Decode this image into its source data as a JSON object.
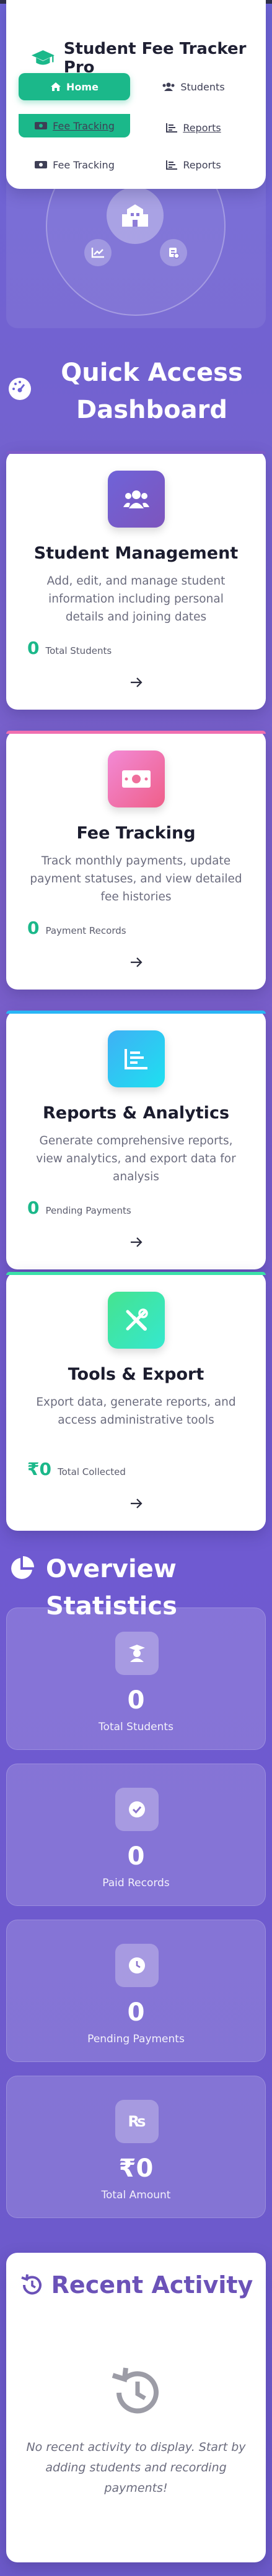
{
  "brand": {
    "title": "Student Fee Tracker Pro"
  },
  "nav": {
    "items": [
      {
        "label": "Home"
      },
      {
        "label": "Students"
      },
      {
        "label": "Fee Tracking"
      },
      {
        "label": "Reports"
      },
      {
        "label": "Fee Tracking"
      },
      {
        "label": "Reports"
      }
    ]
  },
  "quick_access": {
    "title": "Quick Access Dashboard"
  },
  "cards": [
    {
      "title": "Student Management",
      "description": "Add, edit, and manage student information including personal details and joining dates",
      "stat_value": "0",
      "stat_label": "Total Students",
      "accent": "#7c5bc9",
      "icon": "users-icon"
    },
    {
      "title": "Fee Tracking",
      "description": "Track monthly payments, update payment statuses, and view detailed fee histories",
      "stat_value": "0",
      "stat_label": "Payment Records",
      "accent": "#f06fb0",
      "icon": "money-bill-icon"
    },
    {
      "title": "Reports & Analytics",
      "description": "Generate comprehensive reports, view analytics, and export data for analysis",
      "stat_value": "0",
      "stat_label": "Pending Payments",
      "accent": "#29b6f6",
      "icon": "list-chart-icon"
    },
    {
      "title": "Tools & Export",
      "description": "Export data, generate reports, and access administrative tools",
      "stat_value": "₹0",
      "stat_label": "Total Collected",
      "accent": "#3be0a8",
      "icon": "tools-icon"
    }
  ],
  "overview": {
    "title": "Overview Statistics",
    "stats": [
      {
        "value": "0",
        "label": "Total Students",
        "icon": "graduate-icon"
      },
      {
        "value": "0",
        "label": "Paid Records",
        "icon": "check-circle-icon"
      },
      {
        "value": "0",
        "label": "Pending Payments",
        "icon": "clock-icon"
      },
      {
        "value": "₹0",
        "label": "Total Amount",
        "icon": "rupee-icon"
      }
    ]
  },
  "recent": {
    "title": "Recent Activity",
    "empty_text": "No recent activity to display. Start by adding students and recording payments!"
  },
  "colors": {
    "accent_green": "#1bb88a",
    "title_purple": "#6b52b8",
    "background": "#6d64d6"
  }
}
